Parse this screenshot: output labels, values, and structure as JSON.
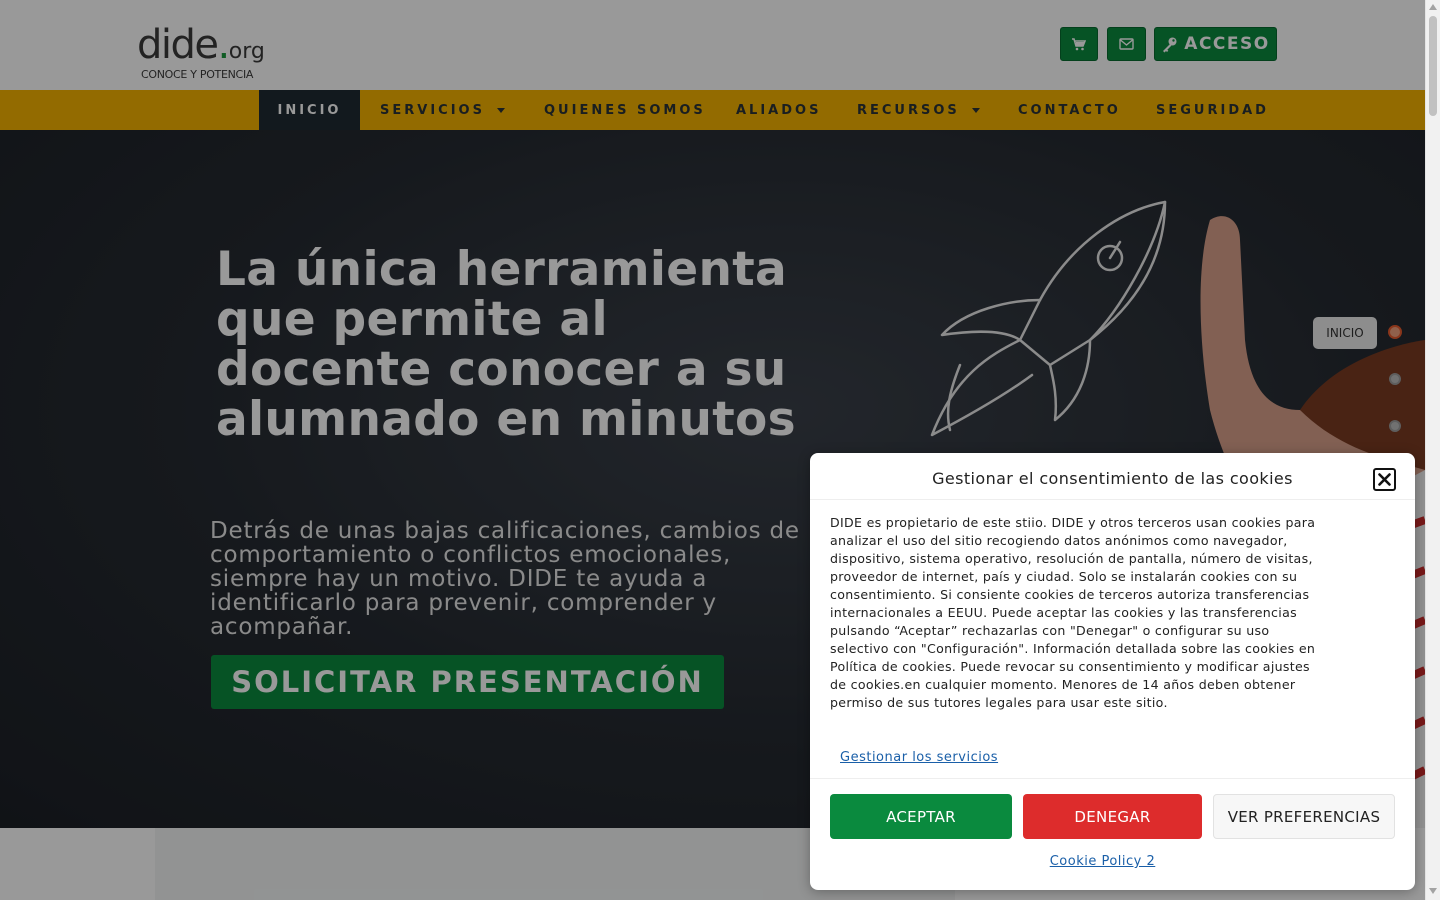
{
  "header": {
    "logo_word": "dide",
    "logo_dot": ".",
    "logo_org": "org",
    "logo_tagline": "CONOCE Y POTENCIA",
    "cart_icon": "cart-icon",
    "mail_icon": "envelope-icon",
    "access_icon": "key-icon",
    "access_label": "ACCESO",
    "brand_green": "#0a8a3e"
  },
  "nav": {
    "items": [
      {
        "label": "INICIO",
        "active": true
      },
      {
        "label": "SERVICIOS",
        "has_dropdown": true
      },
      {
        "label": "QUIENES SOMOS"
      },
      {
        "label": "ALIADOS"
      },
      {
        "label": "RECURSOS",
        "has_dropdown": true
      },
      {
        "label": "CONTACTO"
      },
      {
        "label": "SEGURIDAD"
      }
    ],
    "bar_color": "#f5b301",
    "active_color": "#1f2a33"
  },
  "hero": {
    "title": "La única herramienta que permite al docente conocer a su alumnado en minutos",
    "subtitle": "Detrás de unas bajas calificaciones, cambios de comportamiento o conflictos emocionales,\nsiempre hay un motivo. DIDE te ayuda a identificarlo para prevenir, comprender y acompañar.",
    "cta_label": "SOLICITAR PRESENTACIÓN"
  },
  "dot_nav": {
    "active_label": "INICIO",
    "dots": 3,
    "active_index": 0
  },
  "cookie_modal": {
    "title": "Gestionar el consentimiento de las cookies",
    "body": "DIDE es propietario de este stiio. DIDE y otros terceros usan cookies para analizar el uso del sitio recogiendo datos anónimos como navegador, dispositivo, sistema operativo, resolución de pantalla, número de visitas, proveedor de internet, país y ciudad. Solo se instalarán cookies con su consentimiento. Si consiente cookies de terceros autoriza transferencias internacionales a EEUU. Puede aceptar las cookies y las transferencias pulsando “Aceptar” rechazarlas con \"Denegar\" o configurar su uso selectivo con \"Configuración\". Información detallada sobre las cookies en Política de cookies. Puede revocar su consentimiento y modificar ajustes de cookies.en cualquier momento. Menores de 14 años deben obtener permiso de sus tutores legales para usar este sitio.",
    "manage_link": "Gestionar los servicios",
    "accept_label": "ACEPTAR",
    "deny_label": "DENEGAR",
    "prefs_label": "VER PREFERENCIAS",
    "policy_link": "Cookie Policy 2",
    "close_icon": "close-icon",
    "accept_color": "#0a8a3e",
    "deny_color": "#dd2c2c"
  }
}
